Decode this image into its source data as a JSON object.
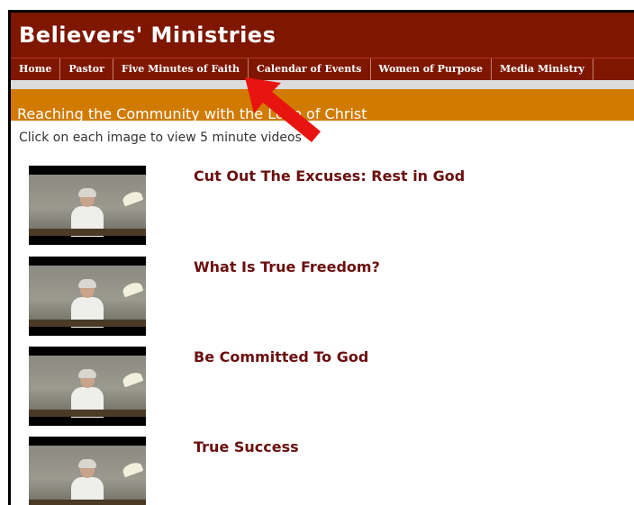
{
  "site": {
    "title": "Believers' Ministries"
  },
  "nav": {
    "items": [
      {
        "label": "Home"
      },
      {
        "label": "Pastor"
      },
      {
        "label": "Five Minutes of Faith"
      },
      {
        "label": "Calendar of Events"
      },
      {
        "label": "Women of Purpose"
      },
      {
        "label": "Media Ministry"
      }
    ]
  },
  "banner": {
    "text": "Reaching the Community with the Love of Christ"
  },
  "main": {
    "instructions": "Click on each image to view 5 minute videos",
    "videos": [
      {
        "title": "Cut Out The Excuses: Rest in God"
      },
      {
        "title": "What Is True Freedom?"
      },
      {
        "title": "Be Committed To God"
      },
      {
        "title": "True Success"
      }
    ]
  },
  "colors": {
    "brand": "#7e1600",
    "banner": "#d17a00",
    "title_text": "#6b0f0f",
    "arrow": "#e8140f"
  },
  "annotation": {
    "icon": "red-pointer-arrow"
  }
}
